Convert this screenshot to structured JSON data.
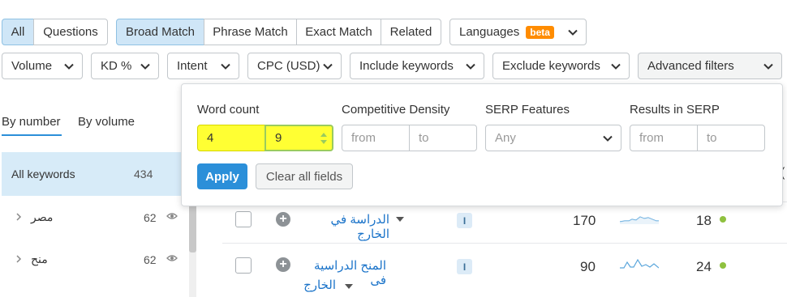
{
  "match_tabs": {
    "all": "All",
    "questions": "Questions",
    "broad": "Broad Match",
    "phrase": "Phrase Match",
    "exact": "Exact Match",
    "related": "Related"
  },
  "languages": {
    "label": "Languages",
    "badge": "beta"
  },
  "filters": {
    "volume": "Volume",
    "kd": "KD %",
    "intent": "Intent",
    "cpc": "CPC (USD)",
    "include": "Include keywords",
    "exclude": "Exclude keywords",
    "advanced": "Advanced filters"
  },
  "view_tabs": {
    "by_number": "By number",
    "by_volume": "By volume"
  },
  "sidebar": {
    "all_label": "All keywords",
    "all_count": "434",
    "groups": [
      {
        "label": "مصر",
        "count": "62"
      },
      {
        "label": "منح",
        "count": "62"
      }
    ]
  },
  "advanced_popup": {
    "word_count_label": "Word count",
    "word_count_from": "4",
    "word_count_to": "9",
    "competitive_density_label": "Competitive Density",
    "cd_from_placeholder": "from",
    "cd_to_placeholder": "to",
    "serp_features_label": "SERP Features",
    "serp_features_value": "Any",
    "results_label": "Results in SERP",
    "res_from_placeholder": "from",
    "res_to_placeholder": "to",
    "apply": "Apply",
    "clear": "Clear all fields"
  },
  "table": {
    "header_partial": "(",
    "rows": [
      {
        "keyword_line1": "الدراسة في الخارج",
        "keyword_line2": "",
        "intent": "I",
        "volume": "170",
        "kd": "18"
      },
      {
        "keyword_line1": "المنح الدراسية فى",
        "keyword_line2": "الخارج",
        "intent": "I",
        "volume": "90",
        "kd": "24"
      }
    ]
  },
  "colors": {
    "accent": "#2b8fd9",
    "selected_bg": "#cfe6f7",
    "highlight": "#ffff33",
    "beta": "#ff8c00",
    "kd_dot": "#8fc13f"
  }
}
